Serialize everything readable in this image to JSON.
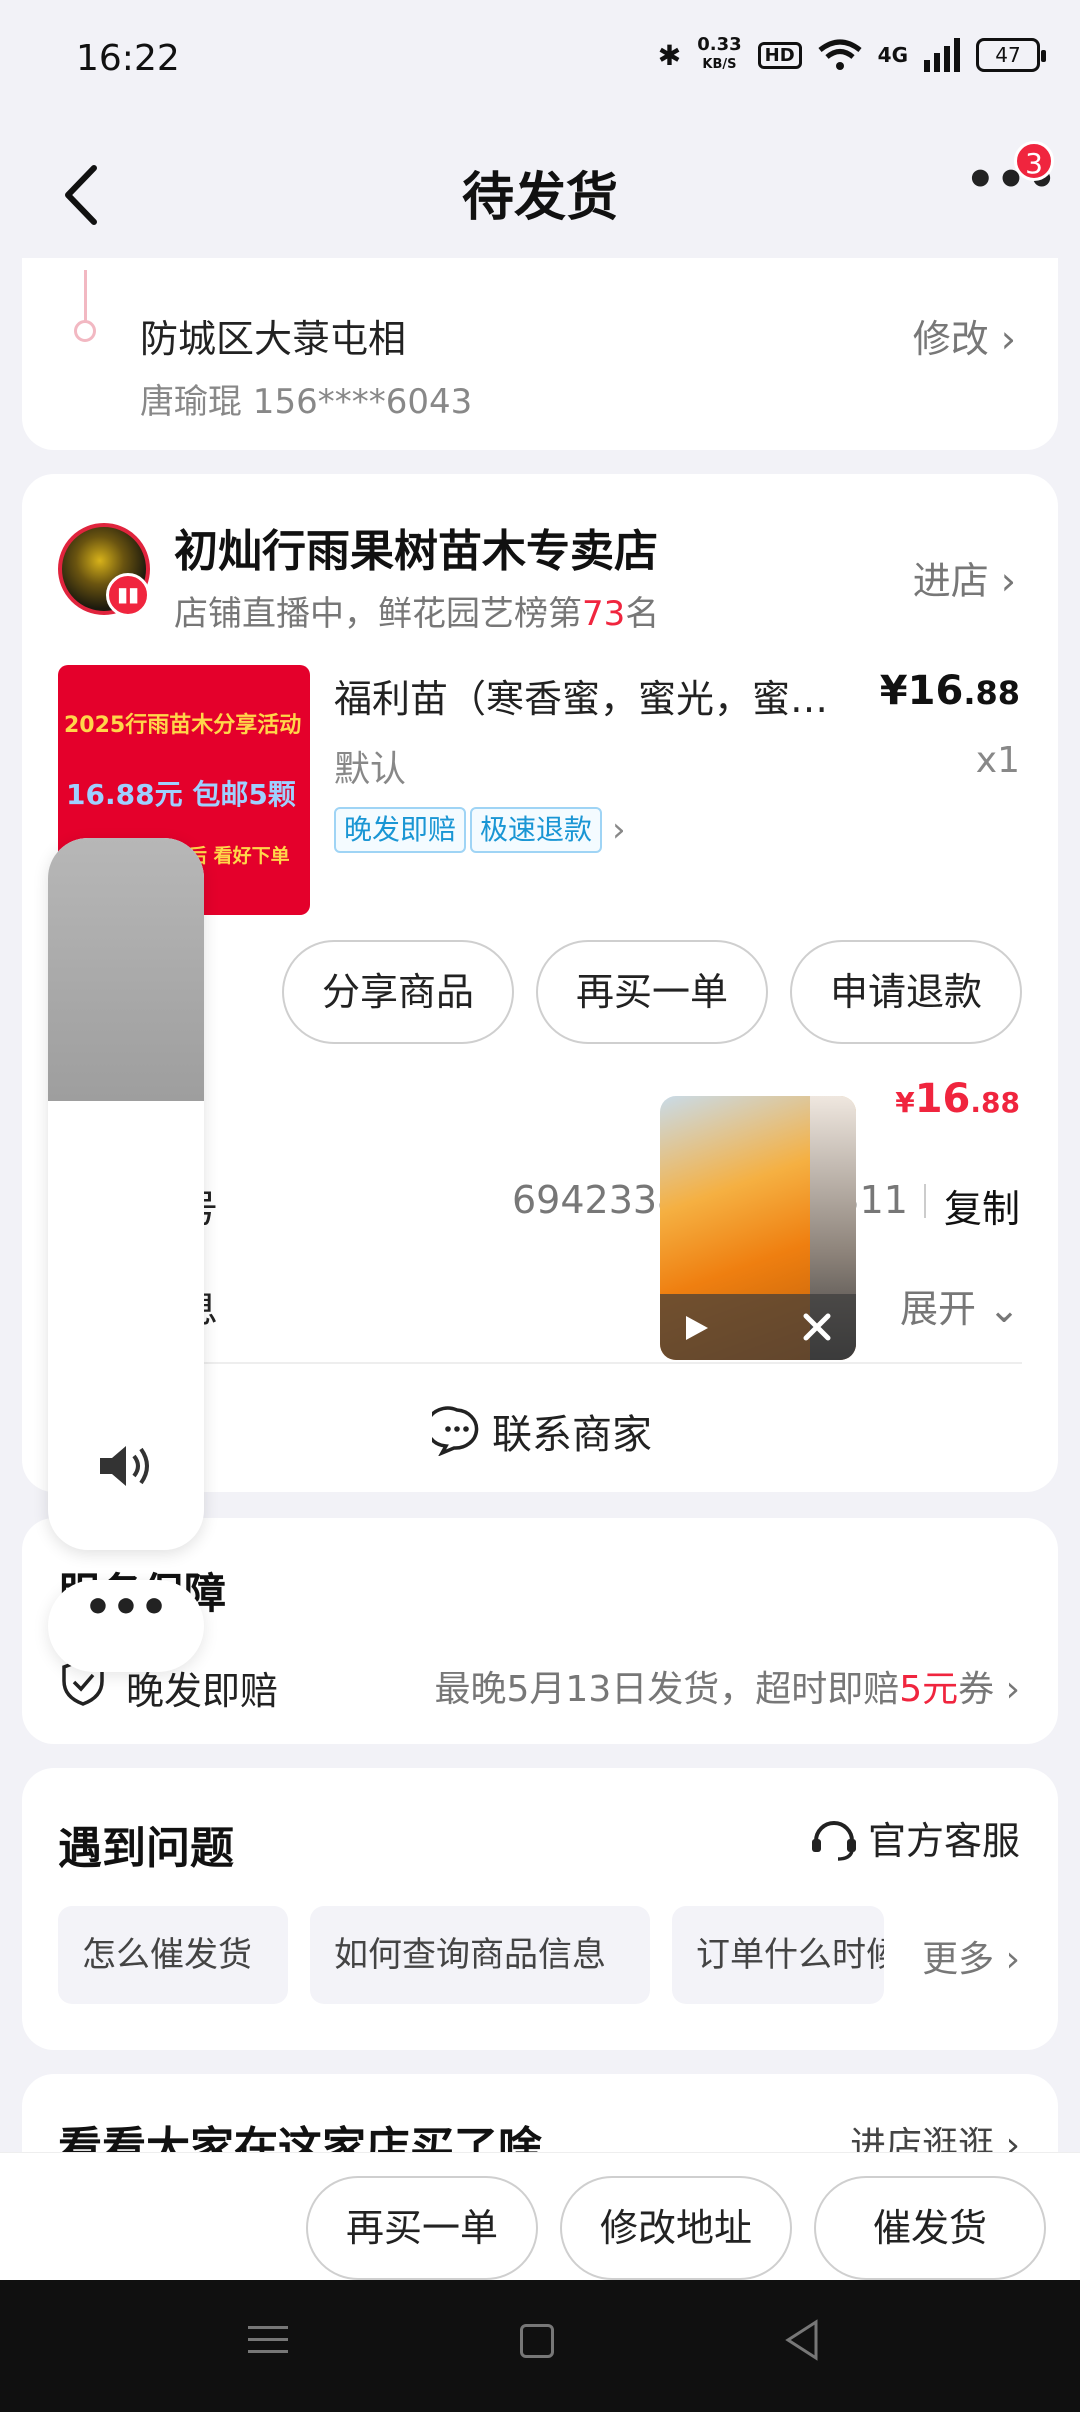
{
  "status_bar": {
    "time": "16:22",
    "speed": "0.33",
    "speed_unit": "KB/S",
    "hd": "HD",
    "network": "4G",
    "battery": "47"
  },
  "header": {
    "title": "待发货",
    "badge_count": "3"
  },
  "address": {
    "detail": "防城区大菉屯相",
    "contact": "唐瑜琨 156****6043",
    "edit": "修改 ›"
  },
  "store": {
    "name": "初灿行雨果树苗木专卖店",
    "sub_prefix": "店铺直播中，鲜花园艺榜第",
    "rank": "73",
    "sub_suffix": "名",
    "enter": "进店 ›"
  },
  "product": {
    "image_text": [
      "2025行雨苗木分享活动",
      "16.88元  包邮5颗",
      "后  看好下单"
    ],
    "title": "福利苗（寒香蜜，蜜光，蜜…",
    "price_symbol": "¥",
    "price_int": "16",
    "price_dec": ".88",
    "spec": "默认",
    "qty": "x1",
    "tags": [
      "晚发即赔",
      "极速退款"
    ]
  },
  "actions": {
    "share": "分享商品",
    "rebuy": "再买一单",
    "refund": "申请退款"
  },
  "order": {
    "total_symbol": "¥",
    "total_int": "16",
    "total_dec": ".88",
    "order_label": "号",
    "order_no": "6942338",
    "order_no_tail": "9311",
    "copy": "复制",
    "info_label": "息",
    "expand": "展开"
  },
  "contact_label": "联系商家",
  "guarantee": {
    "title": "服务保障",
    "name": "晚发即赔",
    "desc_prefix": "最晚5月13日发货，超时即赔",
    "desc_amount": "5元",
    "desc_suffix": "券 ›"
  },
  "questions": {
    "title": "遇到问题",
    "service": "官方客服",
    "chips": [
      "怎么催发货",
      "如何查询商品信息",
      "订单什么时候"
    ],
    "more": "更多 ›"
  },
  "recommend": {
    "title": "看看大家在这家店买了啥",
    "link": "进店逛逛 ›"
  },
  "bottom_actions": {
    "rebuy": "再买一单",
    "edit_address": "修改地址",
    "urge": "催发货"
  },
  "overlay": {
    "volume_level": 0.5,
    "dots": "•••"
  }
}
